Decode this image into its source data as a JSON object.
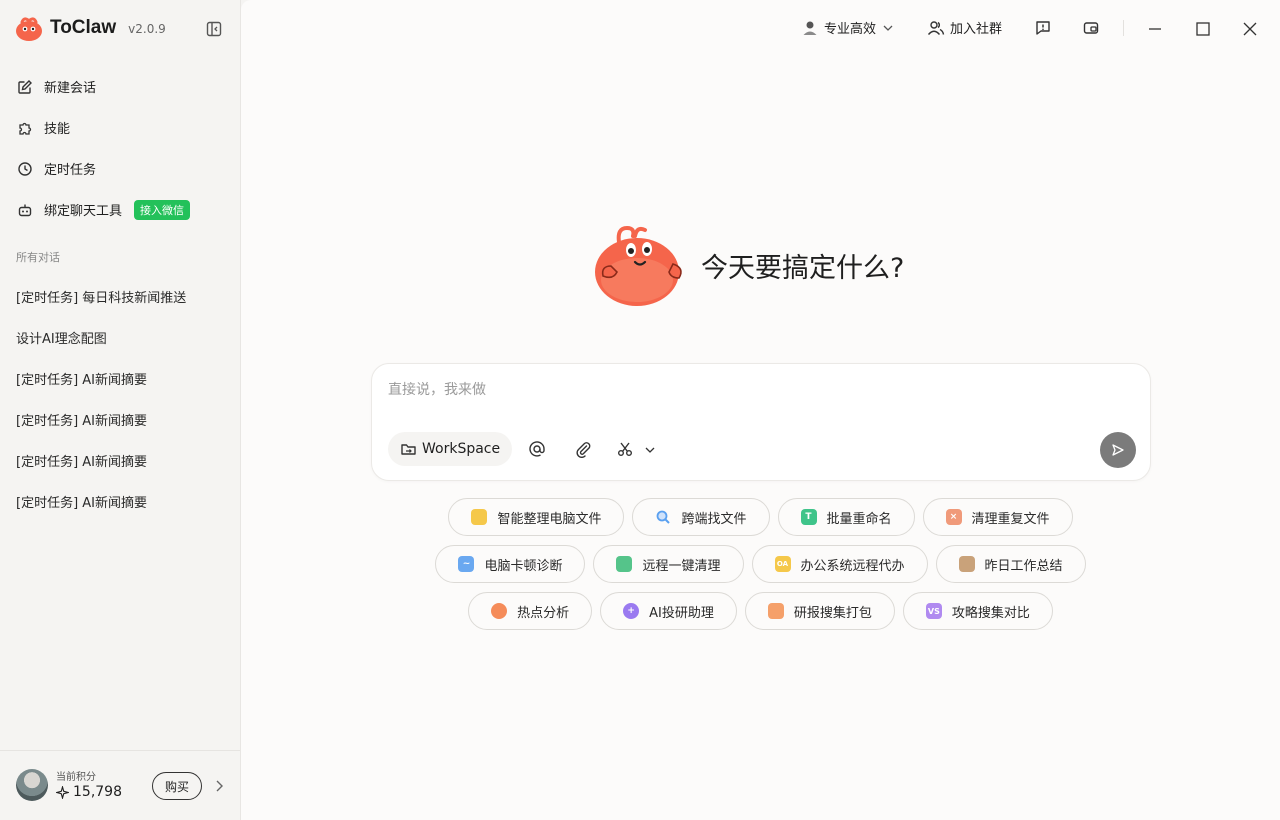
{
  "app": {
    "name": "ToClaw",
    "version": "v2.0.9"
  },
  "sidebar": {
    "nav": [
      {
        "label": "新建会话",
        "icon": "edit-icon"
      },
      {
        "label": "技能",
        "icon": "puzzle-icon"
      },
      {
        "label": "定时任务",
        "icon": "clock-icon"
      },
      {
        "label": "绑定聊天工具",
        "icon": "robot-icon",
        "badge": "接入微信"
      }
    ],
    "section_title": "所有对话",
    "conversations": [
      "[定时任务] 每日科技新闻推送",
      "设计AI理念配图",
      "[定时任务] AI新闻摘要",
      "[定时任务] AI新闻摘要",
      "[定时任务] AI新闻摘要",
      "[定时任务] AI新闻摘要"
    ],
    "footer": {
      "points_label": "当前积分",
      "points_value": "15,798",
      "buy_label": "购买"
    }
  },
  "topbar": {
    "mode_label": "专业高效",
    "community_label": "加入社群"
  },
  "hero": {
    "title": "今天要搞定什么?"
  },
  "composer": {
    "placeholder": "直接说，我来做",
    "workspace_label": "WorkSpace"
  },
  "suggestions": [
    [
      {
        "label": "智能整理电脑文件",
        "color": "#f5c84a",
        "glyph": ""
      },
      {
        "label": "跨端找文件",
        "color": "#5aa0f0",
        "glyph": ""
      },
      {
        "label": "批量重命名",
        "color": "#3fc48a",
        "glyph": "T"
      },
      {
        "label": "清理重复文件",
        "color": "#f09a7a",
        "glyph": "×"
      }
    ],
    [
      {
        "label": "电脑卡顿诊断",
        "color": "#6aa8f0",
        "glyph": "~"
      },
      {
        "label": "远程一键清理",
        "color": "#55c48a",
        "glyph": ""
      },
      {
        "label": "办公系统远程代办",
        "color": "#f5c84a",
        "glyph": "OA"
      },
      {
        "label": "昨日工作总结",
        "color": "#c9a27a",
        "glyph": ""
      }
    ],
    [
      {
        "label": "热点分析",
        "color": "#f58c5a",
        "glyph": ""
      },
      {
        "label": "AI投研助理",
        "color": "#9a7af0",
        "glyph": "+"
      },
      {
        "label": "研报搜集打包",
        "color": "#f5a06a",
        "glyph": ""
      },
      {
        "label": "攻略搜集对比",
        "color": "#b08af0",
        "glyph": "VS"
      }
    ]
  ]
}
